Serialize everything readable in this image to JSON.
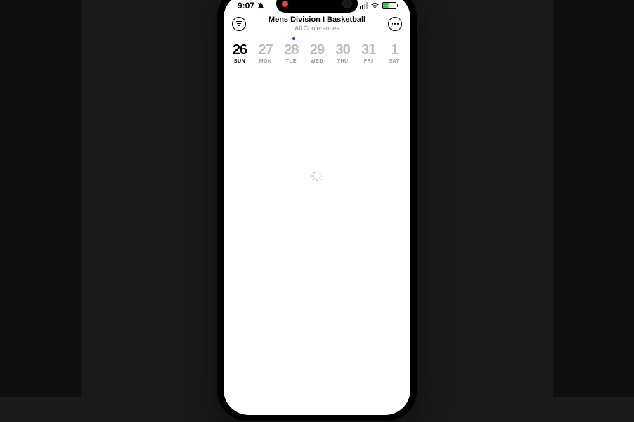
{
  "status_bar": {
    "time": "9:07",
    "recording": true,
    "signal_level": 2,
    "wifi_connected": true,
    "battery_pct": 50,
    "battery_charging": true,
    "do_not_disturb": true
  },
  "header": {
    "title": "Mens Division I Basketball",
    "subtitle": "All Conferences"
  },
  "days": [
    {
      "num": "26",
      "label": "SUN",
      "active": true
    },
    {
      "num": "27",
      "label": "MON",
      "active": false
    },
    {
      "num": "28",
      "label": "TUE",
      "active": false
    },
    {
      "num": "29",
      "label": "WED",
      "active": false
    },
    {
      "num": "30",
      "label": "THU",
      "active": false
    },
    {
      "num": "31",
      "label": "FRI",
      "active": false
    },
    {
      "num": "1",
      "label": "SAT",
      "active": false
    }
  ],
  "content": {
    "state": "loading"
  }
}
